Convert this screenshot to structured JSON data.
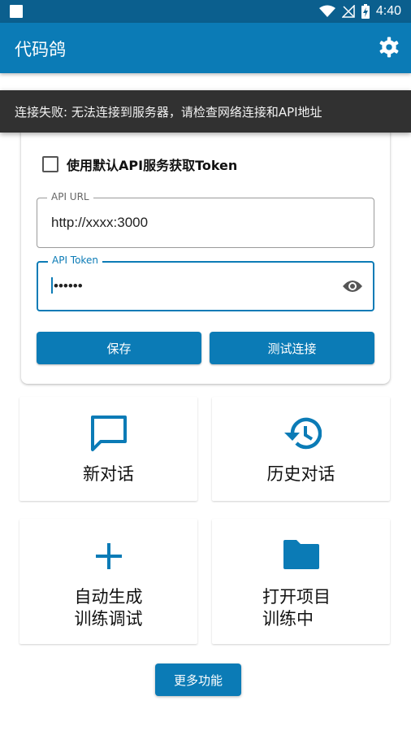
{
  "status_bar": {
    "time": "4:40",
    "icons": [
      "notification-square-icon",
      "wifi-icon",
      "no-signal-icon",
      "battery-charging-icon"
    ]
  },
  "app_bar": {
    "title": "代码鸽",
    "action_icon": "settings-gear-icon"
  },
  "toast": {
    "message": "连接失败: 无法连接到服务器，请检查网络连接和API地址"
  },
  "settings_card": {
    "checkbox": {
      "label": "使用默认API服务获取Token",
      "checked": false
    },
    "api_url": {
      "label": "API URL",
      "value": "http://xxxx:3000"
    },
    "api_token": {
      "label": "API Token",
      "value": "••••••",
      "icon": "eye-icon"
    },
    "save_label": "保存",
    "test_label": "测试连接"
  },
  "tiles": [
    {
      "icon": "chat-bubble-icon",
      "label": "新对话"
    },
    {
      "icon": "history-icon",
      "label": "历史对话"
    },
    {
      "icon": "plus-icon",
      "label_line1": "自动生成",
      "label_line2": "训练调试"
    },
    {
      "icon": "folder-icon",
      "label_line1": "打开项目",
      "label_line2": "训练中"
    }
  ],
  "more_label": "更多功能",
  "colors": {
    "primary": "#0b7bb6",
    "status_bar": "#0b5f8e",
    "toast_bg": "#313131"
  }
}
